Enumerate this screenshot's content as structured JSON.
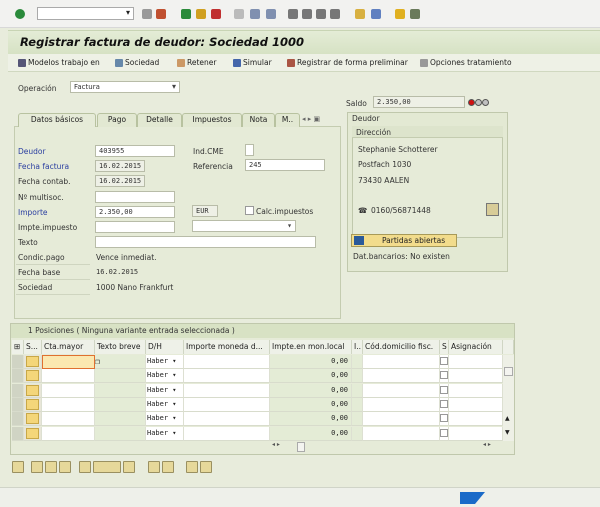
{
  "toolbar": {
    "command_field": "",
    "icons": [
      "enter-icon",
      "back-icon",
      "save-icon",
      "back-green-icon",
      "exit-icon",
      "cancel-icon",
      "print-icon",
      "find-icon",
      "find-next-icon",
      "first-page-icon",
      "prev-page-icon",
      "next-page-icon",
      "last-page-icon",
      "new-session-icon",
      "shortcut-icon",
      "help-icon",
      "layout-icon"
    ]
  },
  "title": "Registrar factura de deudor: Sociedad 1000",
  "app_toolbar": [
    {
      "label": "Modelos trabajo en",
      "icon": "tree-icon"
    },
    {
      "label": "Sociedad",
      "icon": "company-icon"
    },
    {
      "label": "Retener",
      "icon": "hold-icon"
    },
    {
      "label": "Simular",
      "icon": "simulate-icon"
    },
    {
      "label": "Registrar de forma preliminar",
      "icon": "park-icon"
    },
    {
      "label": "Opciones tratamiento",
      "icon": "pencil-icon"
    }
  ],
  "operacion": {
    "label": "Operación",
    "value": "Factura"
  },
  "saldo": {
    "label": "Saldo",
    "value": "2.350,00",
    "status_colors": [
      "#d01010",
      "#c0c0c0",
      "#c0c0c0"
    ]
  },
  "tabs": [
    "Datos básicos",
    "Pago",
    "Detalle",
    "Impuestos",
    "Nota",
    "M.."
  ],
  "form": {
    "deudor": {
      "label": "Deudor",
      "value": "403955"
    },
    "ind_cme": {
      "label": "Ind.CME",
      "value": ""
    },
    "fecha_factura": {
      "label": "Fecha factura",
      "value": "16.02.2015"
    },
    "referencia": {
      "label": "Referencia",
      "value": "245"
    },
    "fecha_contab": {
      "label": "Fecha contab.",
      "value": "16.02.2015"
    },
    "multisoc": {
      "label": "Nº multisoc.",
      "value": ""
    },
    "importe": {
      "label": "Importe",
      "value": "2.350,00",
      "currency": "EUR"
    },
    "calc_impuestos": {
      "label": "Calc.impuestos",
      "checked": false
    },
    "impte_impuesto": {
      "label": "Impte.impuesto",
      "value": "",
      "tax_code": ""
    },
    "texto": {
      "label": "Texto",
      "value": ""
    },
    "condic_pago": {
      "label": "Condic.pago",
      "value": "Vence inmediat."
    },
    "fecha_base": {
      "label": "Fecha base",
      "value": "16.02.2015"
    },
    "sociedad": {
      "label": "Sociedad",
      "value": "1000 Nano Frankfurt"
    }
  },
  "deudor_box": {
    "title": "Deudor",
    "section": "Dirección",
    "name": "Stephanie Schotterer",
    "street": "Postfach 1030",
    "city": "73430 AALEN",
    "phone": "0160/56871448",
    "open_items_button": "Partidas abiertas",
    "bank": "Dat.bancarios: No existen"
  },
  "table": {
    "title": "1 Posiciones ( Ninguna variante entrada seleccionada )",
    "columns": [
      "S...",
      "Cta.mayor",
      "Texto breve",
      "D/H",
      "Importe moneda d...",
      "Impte.en mon.local",
      "I..",
      "Cód.domicilio fisc.",
      "S",
      "Asignación"
    ],
    "rows": [
      {
        "dh": "Haber",
        "local": "0,00"
      },
      {
        "dh": "Haber",
        "local": "0,00"
      },
      {
        "dh": "Haber",
        "local": "0,00"
      },
      {
        "dh": "Haber",
        "local": "0,00"
      },
      {
        "dh": "Haber",
        "local": "0,00"
      },
      {
        "dh": "Haber",
        "local": "0,00"
      }
    ]
  },
  "bottom_buttons": [
    "details-icon",
    "insert-row-icon",
    "delete-row-icon",
    "copy-row-icon",
    "select-all-icon",
    "select-block-icon",
    "deselect-icon",
    "copy-icon",
    "paste-icon",
    "sort-asc-icon",
    "filter-icon"
  ],
  "sap_logo": "SAP"
}
